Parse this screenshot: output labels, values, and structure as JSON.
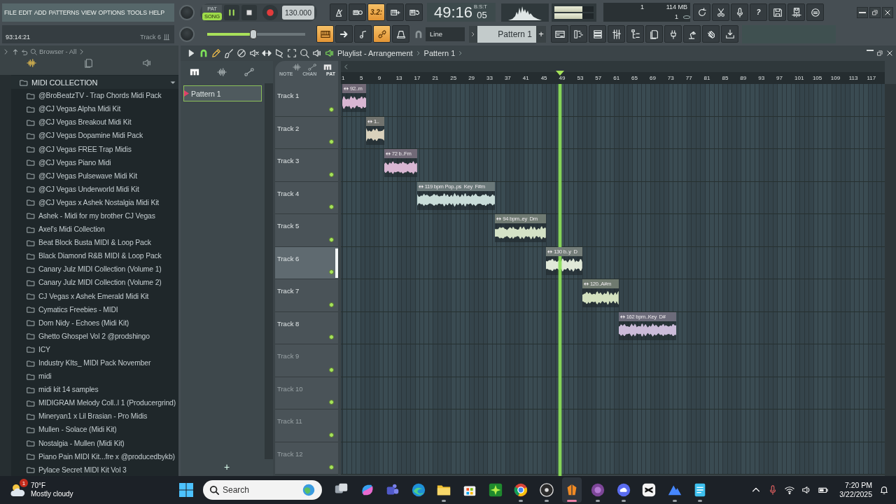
{
  "menu": [
    "FILE",
    "EDIT",
    "ADD",
    "PATTERNS",
    "VIEW",
    "OPTIONS",
    "TOOLS",
    "HELP"
  ],
  "hint": {
    "time": "93:14:21",
    "target": "Track 6"
  },
  "transport": {
    "modes": [
      {
        "label": "PAT",
        "selected": false
      },
      {
        "label": "SONG",
        "selected": true
      }
    ],
    "playing": true,
    "tempo": "130.000",
    "volume": {
      "level": 0.47
    }
  },
  "record_tools": [
    {
      "kind": "metronome",
      "on": false
    },
    {
      "kind": "wait",
      "on": false
    },
    {
      "kind": "countdown",
      "label": "3.2:",
      "on": true
    },
    {
      "kind": "step",
      "on": false
    },
    {
      "kind": "loop",
      "on": false
    }
  ],
  "time_display": {
    "main": "49:16",
    "fraction": "05",
    "unit": "B:S:T"
  },
  "output_meters": [
    {
      "level": 0.72
    },
    {
      "level": 0.72
    }
  ],
  "system": {
    "readout_1": "1",
    "memory": "114 MB",
    "readout_2": "1"
  },
  "app_tools": [
    {
      "kind": "refresh"
    },
    {
      "kind": "scissors"
    },
    {
      "kind": "mic"
    },
    {
      "kind": "help",
      "label": "?"
    },
    {
      "kind": "save"
    },
    {
      "kind": "export"
    },
    {
      "kind": "chat"
    }
  ],
  "edit_tools": [
    {
      "kind": "typing",
      "on": true
    },
    {
      "kind": "arrow",
      "on": false
    },
    {
      "kind": "note",
      "on": false
    },
    {
      "kind": "link",
      "on": true
    },
    {
      "kind": "knob",
      "on": false
    }
  ],
  "snap": {
    "value": "Line"
  },
  "pattern_selector": {
    "value": "Pattern 1",
    "add": "+"
  },
  "window_tools": [
    {
      "kind": "playlist"
    },
    {
      "kind": "steps"
    },
    {
      "kind": "channels"
    },
    {
      "kind": "mixer"
    },
    {
      "kind": "tree"
    },
    {
      "kind": "doc"
    },
    {
      "kind": "plug"
    },
    {
      "kind": "lamp"
    },
    {
      "kind": "hand"
    },
    {
      "kind": "download"
    }
  ],
  "browser": {
    "title": "Browser - All",
    "tree": [
      {
        "label": "MIDI COLLECTION",
        "children": [
          {
            "label": "@BroBeatzTV - Trap Chords Midi Pack"
          },
          {
            "label": "@CJ Vegas Alpha Midi Kit"
          },
          {
            "label": "@CJ Vegas Breakout Midi Kit"
          },
          {
            "label": "@CJ Vegas Dopamine Midi Pack"
          },
          {
            "label": "@CJ Vegas FREE Trap Midis"
          },
          {
            "label": "@CJ Vegas Piano Midi"
          },
          {
            "label": "@CJ Vegas Pulsewave Midi Kit"
          },
          {
            "label": "@CJ Vegas Underworld Midi Kit"
          },
          {
            "label": "@CJ Vegas x Ashek Nostalgia Midi Kit"
          },
          {
            "label": "Ashek - Midi for my brother CJ Vegas"
          },
          {
            "label": "Axel's Midi Collection"
          },
          {
            "label": "Beat Block Busta MIDI & Loop Pack"
          },
          {
            "label": "Black Diamond R&B MIDI & Loop Pack"
          },
          {
            "label": "Canary Julz MIDI Collection (Volume 1)"
          },
          {
            "label": "Canary Julz MIDI Collection (Volume 2)"
          },
          {
            "label": "CJ Vegas x Ashek Emerald Midi Kit"
          },
          {
            "label": "Cymatics Freebies - MIDI"
          },
          {
            "label": "Dom Nidy - Echoes (Midi Kit)"
          },
          {
            "label": "Ghetto Ghospel Vol 2 @prodshingo"
          },
          {
            "label": "ICY"
          },
          {
            "label": "Industry KIts_ MIDI Pack November"
          },
          {
            "label": "midi"
          },
          {
            "label": "midi kit 14 samples"
          },
          {
            "label": "MIDIGRAM Melody Coll..l 1 (Producergrind)"
          },
          {
            "label": "Mineryan1 x Lil Brasian - Pro Midis"
          },
          {
            "label": "Mullen - Solace (Midi Kit)"
          },
          {
            "label": "Nostalgia - Mullen (Midi Kit)"
          },
          {
            "label": "Piano Pain MIDI Kit...fre x @producedbykb)"
          },
          {
            "label": "Pylace Secret MIDI Kit Vol 3"
          }
        ]
      }
    ]
  },
  "playlist": {
    "tools": [
      {
        "kind": "play"
      },
      {
        "kind": "magnet",
        "on": true
      },
      {
        "kind": "pencil",
        "selected": true
      },
      {
        "kind": "brush",
        "selected": false
      },
      {
        "kind": "mute",
        "selected": false
      },
      {
        "kind": "speakermute",
        "selected": false
      },
      {
        "kind": "slip",
        "selected": false
      },
      {
        "kind": "slice",
        "selected": false
      },
      {
        "kind": "select",
        "selected": false
      },
      {
        "kind": "zoom",
        "selected": false
      },
      {
        "kind": "playback",
        "selected": false
      }
    ],
    "title": "Playlist - Arrangement",
    "pattern": "Pattern 1",
    "patterns": [
      {
        "label": "Pattern 1",
        "selected": true
      }
    ],
    "add": "+",
    "filters": [
      {
        "label": "NOTE",
        "selected": false
      },
      {
        "label": "CHAN",
        "selected": false
      },
      {
        "label": "PAT",
        "selected": true
      }
    ],
    "ruler": [
      "1",
      "5",
      "9",
      "13",
      "17",
      "21",
      "25",
      "29",
      "33",
      "37",
      "41",
      "45",
      "49",
      "53",
      "57",
      "61",
      "65",
      "69",
      "73",
      "77",
      "81",
      "85",
      "89",
      "93",
      "97",
      "101",
      "105",
      "109",
      "113",
      "117"
    ],
    "tracks": [
      {
        "name": "Track 1",
        "disabled": false,
        "selected": false,
        "clips": [
          {
            "label": "92..m",
            "color": "#d8b6d2"
          }
        ]
      },
      {
        "name": "Track 2",
        "disabled": false,
        "selected": false,
        "clips": [
          {
            "label": "1..",
            "color": "#d9d1bc"
          }
        ]
      },
      {
        "name": "Track 3",
        "disabled": false,
        "selected": false,
        "clips": [
          {
            "label": "72 b..Fm",
            "color": "#d8b6d2"
          }
        ]
      },
      {
        "name": "Track 4",
        "disabled": false,
        "selected": false,
        "clips": [
          {
            "label": "119 bpm Pop..ps  Key  F#m",
            "color": "#c8dcd8"
          }
        ]
      },
      {
        "name": "Track 5",
        "disabled": false,
        "selected": false,
        "clips": [
          {
            "label": "94 bpm..ey  Dm",
            "color": "#d4e2c6"
          }
        ]
      },
      {
        "name": "Track 6",
        "disabled": false,
        "selected": true,
        "clips": [
          {
            "label": "130 b..y  D",
            "color": "#e0e8d8"
          }
        ]
      },
      {
        "name": "Track 7",
        "disabled": false,
        "selected": false,
        "clips": [
          {
            "label": "120..A#m",
            "color": "#d3e1bf"
          }
        ]
      },
      {
        "name": "Track 8",
        "disabled": false,
        "selected": false,
        "clips": [
          {
            "label": "162 bpm..Key  D#",
            "color": "#cbbbd9"
          }
        ]
      },
      {
        "name": "Track 9",
        "disabled": true,
        "selected": false
      },
      {
        "name": "Track 10",
        "disabled": true,
        "selected": false
      },
      {
        "name": "Track 11",
        "disabled": true,
        "selected": false
      },
      {
        "name": "Track 12",
        "disabled": true,
        "selected": false
      }
    ]
  },
  "taskbar": {
    "weather": {
      "badge": "1",
      "temperature": "70°F",
      "condition": "Mostly cloudy"
    },
    "search": {
      "placeholder": "Search"
    },
    "apps": [
      {
        "kind": "taskview",
        "running": false,
        "selected": false
      },
      {
        "kind": "swirl",
        "running": false,
        "selected": false
      },
      {
        "kind": "people",
        "running": false,
        "selected": false
      },
      {
        "kind": "globe",
        "running": false,
        "selected": false
      },
      {
        "kind": "folder",
        "running": true,
        "selected": false
      },
      {
        "kind": "bag",
        "running": false,
        "selected": false
      },
      {
        "kind": "burst",
        "running": false,
        "selected": false
      },
      {
        "kind": "ring",
        "running": true,
        "selected": false
      },
      {
        "kind": "disc",
        "running": true,
        "selected": false
      },
      {
        "kind": "fruit",
        "running": true,
        "selected": true
      },
      {
        "kind": "onion",
        "running": true,
        "selected": false
      },
      {
        "kind": "cloud",
        "running": true,
        "selected": false
      },
      {
        "kind": "cut",
        "running": false,
        "selected": false
      },
      {
        "kind": "mountain",
        "running": true,
        "selected": false
      },
      {
        "kind": "notepad",
        "running": true,
        "selected": false
      }
    ],
    "clock": {
      "time": "7:20 PM",
      "date": "3/22/2025"
    }
  }
}
